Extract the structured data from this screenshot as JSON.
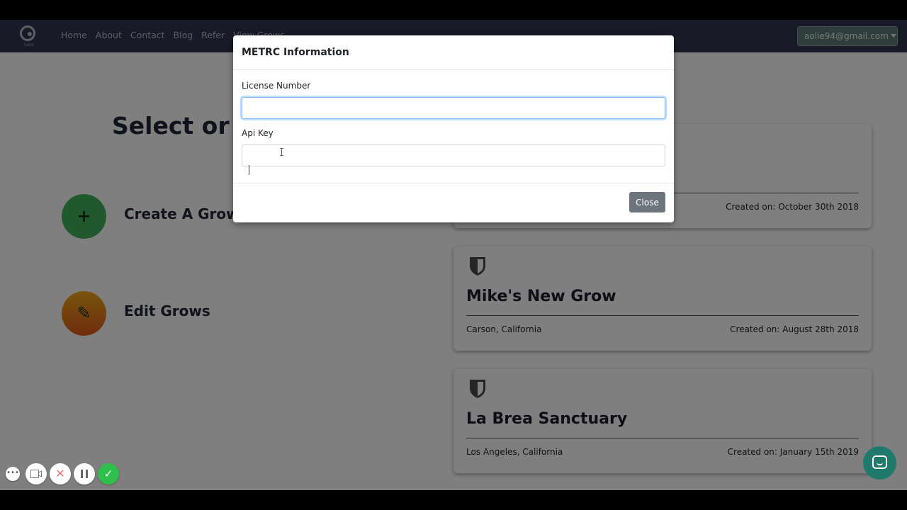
{
  "navbar": {
    "logo_text": "Lens",
    "links": [
      "Home",
      "About",
      "Contact",
      "Blog",
      "Refer",
      "View Grows"
    ],
    "user_email": "aolie94@gmail.com"
  },
  "page": {
    "title": "Select or C",
    "actions": [
      {
        "label": "Create A Grow",
        "icon": "plus-icon",
        "glyph": "+"
      },
      {
        "label": "Edit Grows",
        "icon": "pencil-icon",
        "glyph": "✎"
      }
    ]
  },
  "grows": [
    {
      "name": "",
      "location": "",
      "created": "Created on: October 30th 2018"
    },
    {
      "name": "Mike's New Grow",
      "location": "Carson, California",
      "created": "Created on: August 28th 2018"
    },
    {
      "name": "La Brea Sanctuary",
      "location": "Los Angeles, California",
      "created": "Created on: January 15th 2019"
    }
  ],
  "modal": {
    "title": "METRC Information",
    "license_label": "License Number",
    "license_value": "",
    "api_key_label": "Api Key",
    "api_key_value": "",
    "close_label": "Close"
  },
  "recorder": {
    "buttons": [
      "more-icon",
      "camera-icon",
      "cancel-icon",
      "pause-icon",
      "check-icon"
    ]
  },
  "colors": {
    "navbar": "#303450",
    "create_circle": "#3fb25a",
    "user_button": "#5f7c75",
    "close_button": "#6c757d",
    "chat_bubble": "#1f7a6c"
  }
}
